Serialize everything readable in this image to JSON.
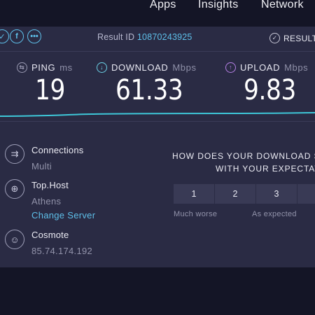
{
  "nav": {
    "items": [
      "Apps",
      "Insights",
      "Network"
    ]
  },
  "result_bar": {
    "share_icons": [
      "twitter-icon",
      "facebook-icon",
      "more-icon"
    ],
    "result_id_label": "Result ID",
    "result_id": "10870243925",
    "results_label": "RESULT"
  },
  "metrics": {
    "ping": {
      "name": "PING",
      "unit": "ms",
      "value": "19"
    },
    "download": {
      "name": "DOWNLOAD",
      "unit": "Mbps",
      "value": "61.33"
    },
    "upload": {
      "name": "UPLOAD",
      "unit": "Mbps",
      "value": "9.83"
    }
  },
  "server_info": {
    "connections_label": "Connections",
    "connections_value": "Multi",
    "host_label": "Top.Host",
    "host_location": "Athens",
    "change_server_label": "Change Server",
    "isp_label": "Cosmote",
    "ip": "85.74.174.192"
  },
  "survey": {
    "question_line1": "HOW DOES YOUR DOWNLOAD SP",
    "question_line2": "WITH YOUR EXPECTATI",
    "ratings": [
      "1",
      "2",
      "3",
      ""
    ],
    "scale_low": "Much worse",
    "scale_mid": "As expected"
  },
  "colors": {
    "background": "#141526",
    "panel": "#2a2b44",
    "accent_blue": "#5ec0ea",
    "download_cyan": "#6cd3e8",
    "upload_purple": "#b680e6"
  }
}
